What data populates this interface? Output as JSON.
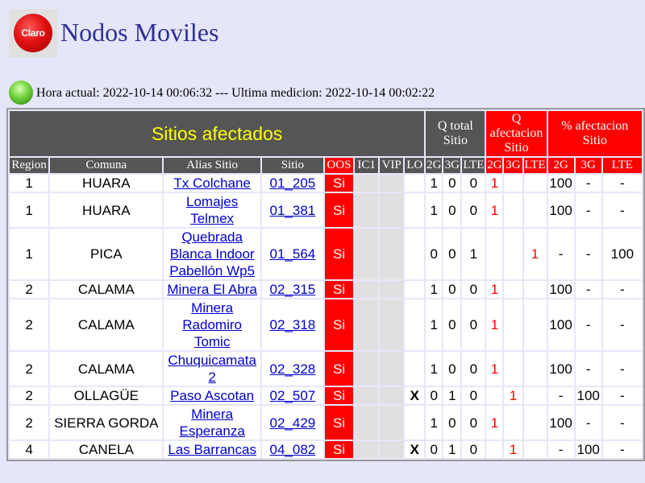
{
  "header": {
    "logo_text": "Claro",
    "title": "Nodos Moviles"
  },
  "status": {
    "text": "Hora actual: 2022-10-14 00:06:32 --- Ultima medicion: 2022-10-14 00:02:22"
  },
  "table": {
    "title": "Sitios afectados",
    "group_headers": {
      "q_total": "Q total Sitio",
      "q_afectacion": "Q afectacion Sitio",
      "pct_afectacion": "% afectacion Sitio"
    },
    "columns": [
      "Region",
      "Comuna",
      "Alias Sitio",
      "Sitio",
      "OOS",
      "IC1",
      "VIP",
      "LO",
      "2G",
      "3G",
      "LTE",
      "2G",
      "3G",
      "LTE",
      "2G",
      "3G",
      "LTE"
    ],
    "rows": [
      {
        "region": "1",
        "comuna": "HUARA",
        "alias": "Tx Colchane",
        "sitio": "01_205",
        "oos": "Si",
        "lo": "",
        "qt2g": "1",
        "qt3g": "0",
        "qtlte": "0",
        "qa2g": "1",
        "qa3g": "",
        "qalte": "",
        "p2g": "100",
        "p3g": "-",
        "plte": "-"
      },
      {
        "region": "1",
        "comuna": "HUARA",
        "alias": "Lomajes Telmex",
        "sitio": "01_381",
        "oos": "Si",
        "lo": "",
        "qt2g": "1",
        "qt3g": "0",
        "qtlte": "0",
        "qa2g": "1",
        "qa3g": "",
        "qalte": "",
        "p2g": "100",
        "p3g": "-",
        "plte": "-"
      },
      {
        "region": "1",
        "comuna": "PICA",
        "alias": "Quebrada Blanca Indoor Pabellón Wp5",
        "sitio": "01_564",
        "oos": "Si",
        "lo": "",
        "qt2g": "0",
        "qt3g": "0",
        "qtlte": "1",
        "qa2g": "",
        "qa3g": "",
        "qalte": "1",
        "p2g": "-",
        "p3g": "-",
        "plte": "100"
      },
      {
        "region": "2",
        "comuna": "CALAMA",
        "alias": "Minera El Abra",
        "sitio": "02_315",
        "oos": "Si",
        "lo": "",
        "qt2g": "1",
        "qt3g": "0",
        "qtlte": "0",
        "qa2g": "1",
        "qa3g": "",
        "qalte": "",
        "p2g": "100",
        "p3g": "-",
        "plte": "-"
      },
      {
        "region": "2",
        "comuna": "CALAMA",
        "alias": "Minera Radomiro Tomic",
        "sitio": "02_318",
        "oos": "Si",
        "lo": "",
        "qt2g": "1",
        "qt3g": "0",
        "qtlte": "0",
        "qa2g": "1",
        "qa3g": "",
        "qalte": "",
        "p2g": "100",
        "p3g": "-",
        "plte": "-"
      },
      {
        "region": "2",
        "comuna": "CALAMA",
        "alias": "Chuquicamata 2",
        "sitio": "02_328",
        "oos": "Si",
        "lo": "",
        "qt2g": "1",
        "qt3g": "0",
        "qtlte": "0",
        "qa2g": "1",
        "qa3g": "",
        "qalte": "",
        "p2g": "100",
        "p3g": "-",
        "plte": "-"
      },
      {
        "region": "2",
        "comuna": "OLLAGÜE",
        "alias": "Paso Ascotan",
        "sitio": "02_507",
        "oos": "Si",
        "lo": "X",
        "qt2g": "0",
        "qt3g": "1",
        "qtlte": "0",
        "qa2g": "",
        "qa3g": "1",
        "qalte": "",
        "p2g": "-",
        "p3g": "100",
        "plte": "-"
      },
      {
        "region": "2",
        "comuna": "SIERRA GORDA",
        "alias": "Minera Esperanza",
        "sitio": "02_429",
        "oos": "Si",
        "lo": "",
        "qt2g": "1",
        "qt3g": "0",
        "qtlte": "0",
        "qa2g": "1",
        "qa3g": "",
        "qalte": "",
        "p2g": "100",
        "p3g": "-",
        "plte": "-"
      },
      {
        "region": "4",
        "comuna": "CANELA",
        "alias": "Las Barrancas",
        "sitio": "04_082",
        "oos": "Si",
        "lo": "X",
        "qt2g": "0",
        "qt3g": "1",
        "qtlte": "0",
        "qa2g": "",
        "qa3g": "1",
        "qalte": "",
        "p2g": "-",
        "p3g": "100",
        "plte": "-"
      }
    ]
  },
  "colors": {
    "background": "#e6e6fa",
    "title": "#2e3192",
    "header_dark": "#555555",
    "header_red": "#ff0000",
    "oos_red": "#ff0000",
    "link": "#0000cc",
    "status_led": "#6fd13a"
  },
  "icons": {
    "logo": "claro-logo-icon",
    "status": "green-led-icon"
  }
}
